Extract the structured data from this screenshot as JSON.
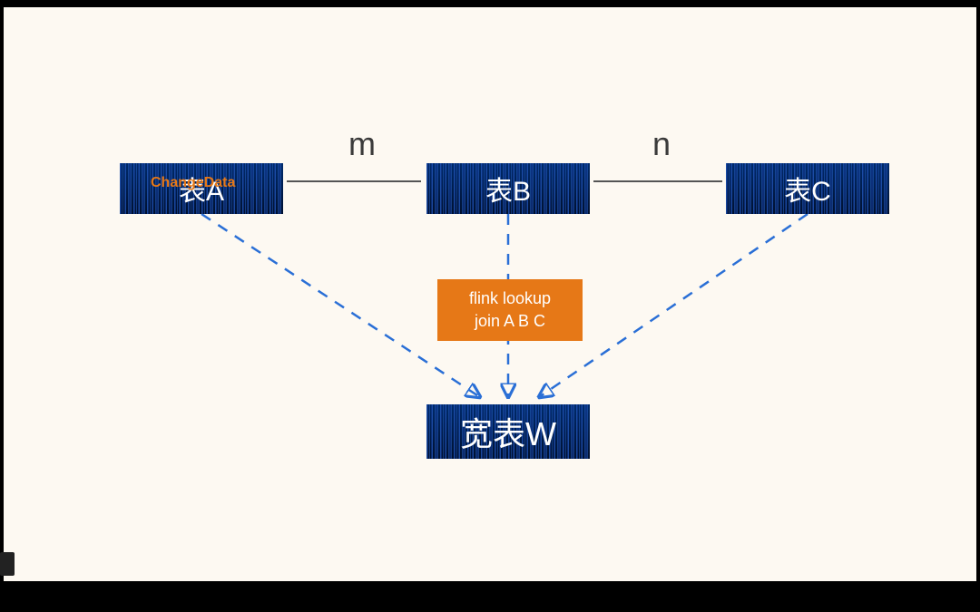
{
  "nodes": {
    "a": {
      "label": "表A",
      "overlay": "ChangeData"
    },
    "b": {
      "label": "表B"
    },
    "c": {
      "label": "表C"
    },
    "w": {
      "label": "宽表W"
    }
  },
  "edges": {
    "ab_label": "m",
    "bc_label": "n"
  },
  "process": {
    "line1": "flink  lookup",
    "line2": "join A B C"
  }
}
